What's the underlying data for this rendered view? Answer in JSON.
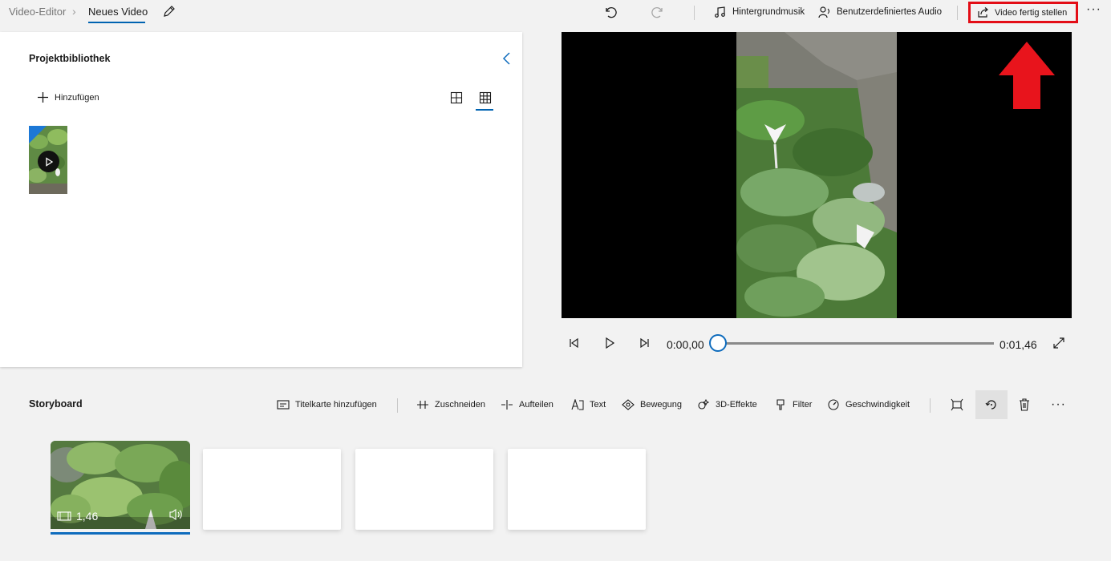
{
  "breadcrumb": {
    "root": "Video-Editor",
    "separator": "›",
    "current": "Neues Video"
  },
  "toolbar": {
    "background_music": "Hintergrundmusik",
    "custom_audio": "Benutzerdefiniertes Audio",
    "finish_video": "Video fertig stellen",
    "more": "···"
  },
  "library": {
    "title": "Projektbibliothek",
    "add_label": "Hinzufügen"
  },
  "playback": {
    "current_time": "0:00,00",
    "total_time": "0:01,46",
    "progress": 0
  },
  "storyboard": {
    "title": "Storyboard",
    "tools": {
      "title_card": "Titelkarte hinzufügen",
      "trim": "Zuschneiden",
      "split": "Aufteilen",
      "text": "Text",
      "motion": "Bewegung",
      "effects_3d": "3D-Effekte",
      "filter": "Filter",
      "speed": "Geschwindigkeit"
    },
    "more": "···",
    "clips": [
      {
        "duration": "1,46"
      }
    ]
  },
  "colors": {
    "accent": "#0f6cbd",
    "highlight": "#e30d16",
    "library_corner": "#1c78d6"
  }
}
